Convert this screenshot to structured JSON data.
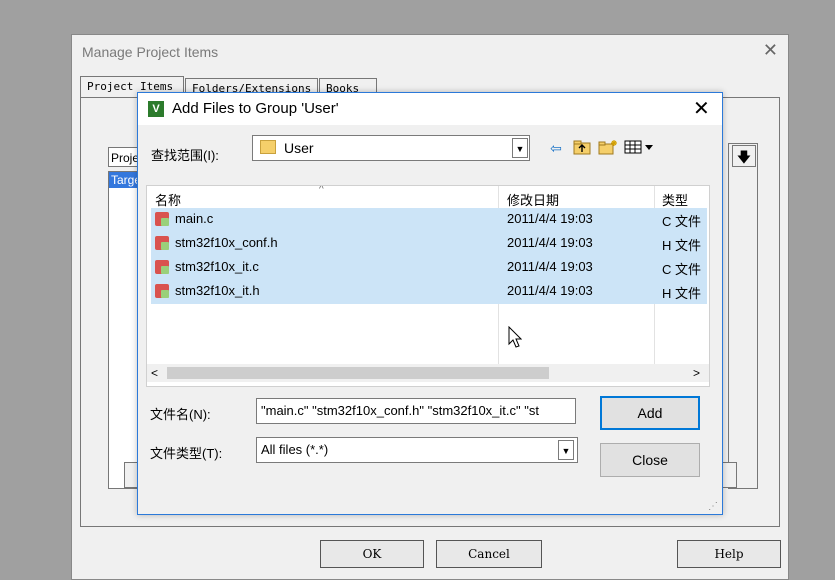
{
  "outer_dialog": {
    "title": "Manage Project Items",
    "close_glyph": "✕",
    "tabs": [
      "Project Items",
      "Folders/Extensions",
      "Books"
    ],
    "background_project_label": "Proje",
    "background_list_item": "Targe",
    "buttons": {
      "ok": "OK",
      "cancel": "Cancel",
      "help": "Help"
    }
  },
  "dialog": {
    "title": "Add Files to Group 'User'",
    "close_glyph": "✕",
    "look_in": {
      "label": "查找范围(I):",
      "value": "User"
    },
    "toolbar_icons": [
      "back-arrow-icon",
      "up-folder-icon",
      "new-folder-icon",
      "view-menu-icon"
    ],
    "columns": {
      "name": "名称",
      "date": "修改日期",
      "type": "类型"
    },
    "files": [
      {
        "name": "main.c",
        "date": "2011/4/4 19:03",
        "type": "C 文件"
      },
      {
        "name": "stm32f10x_conf.h",
        "date": "2011/4/4 19:03",
        "type": "H 文件"
      },
      {
        "name": "stm32f10x_it.c",
        "date": "2011/4/4 19:03",
        "type": "C 文件"
      },
      {
        "name": "stm32f10x_it.h",
        "date": "2011/4/4 19:03",
        "type": "H 文件"
      }
    ],
    "filename": {
      "label": "文件名(N):",
      "value": "\"main.c\" \"stm32f10x_conf.h\" \"stm32f10x_it.c\" \"st"
    },
    "filetype": {
      "label": "文件类型(T):",
      "value": "All files (*.*)"
    },
    "buttons": {
      "add": "Add",
      "close": "Close"
    }
  },
  "colors": {
    "selection": "#cce4f7",
    "dialog_border": "#2b79d9",
    "button_focus": "#0078d7"
  }
}
